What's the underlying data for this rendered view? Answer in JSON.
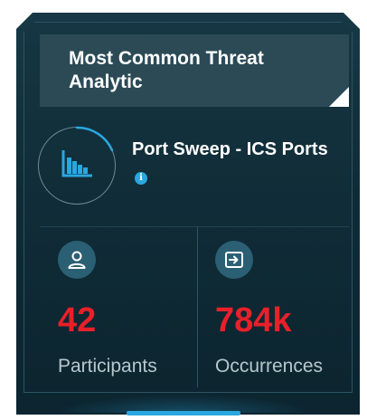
{
  "card": {
    "title": "Most Common Threat Analytic",
    "threat_name": "Port Sweep - ICS Ports",
    "threat_icon": "bar-chart-icon",
    "info_icon_glyph": "i"
  },
  "stats": [
    {
      "value": "42",
      "label": "Participants",
      "icon": "user-icon"
    },
    {
      "value": "784k",
      "label": "Occurrences",
      "icon": "sign-in-icon"
    }
  ],
  "colors": {
    "accent": "#2aa7e0",
    "stat_value": "#e8202a",
    "card_bg": "#0f2b36"
  }
}
